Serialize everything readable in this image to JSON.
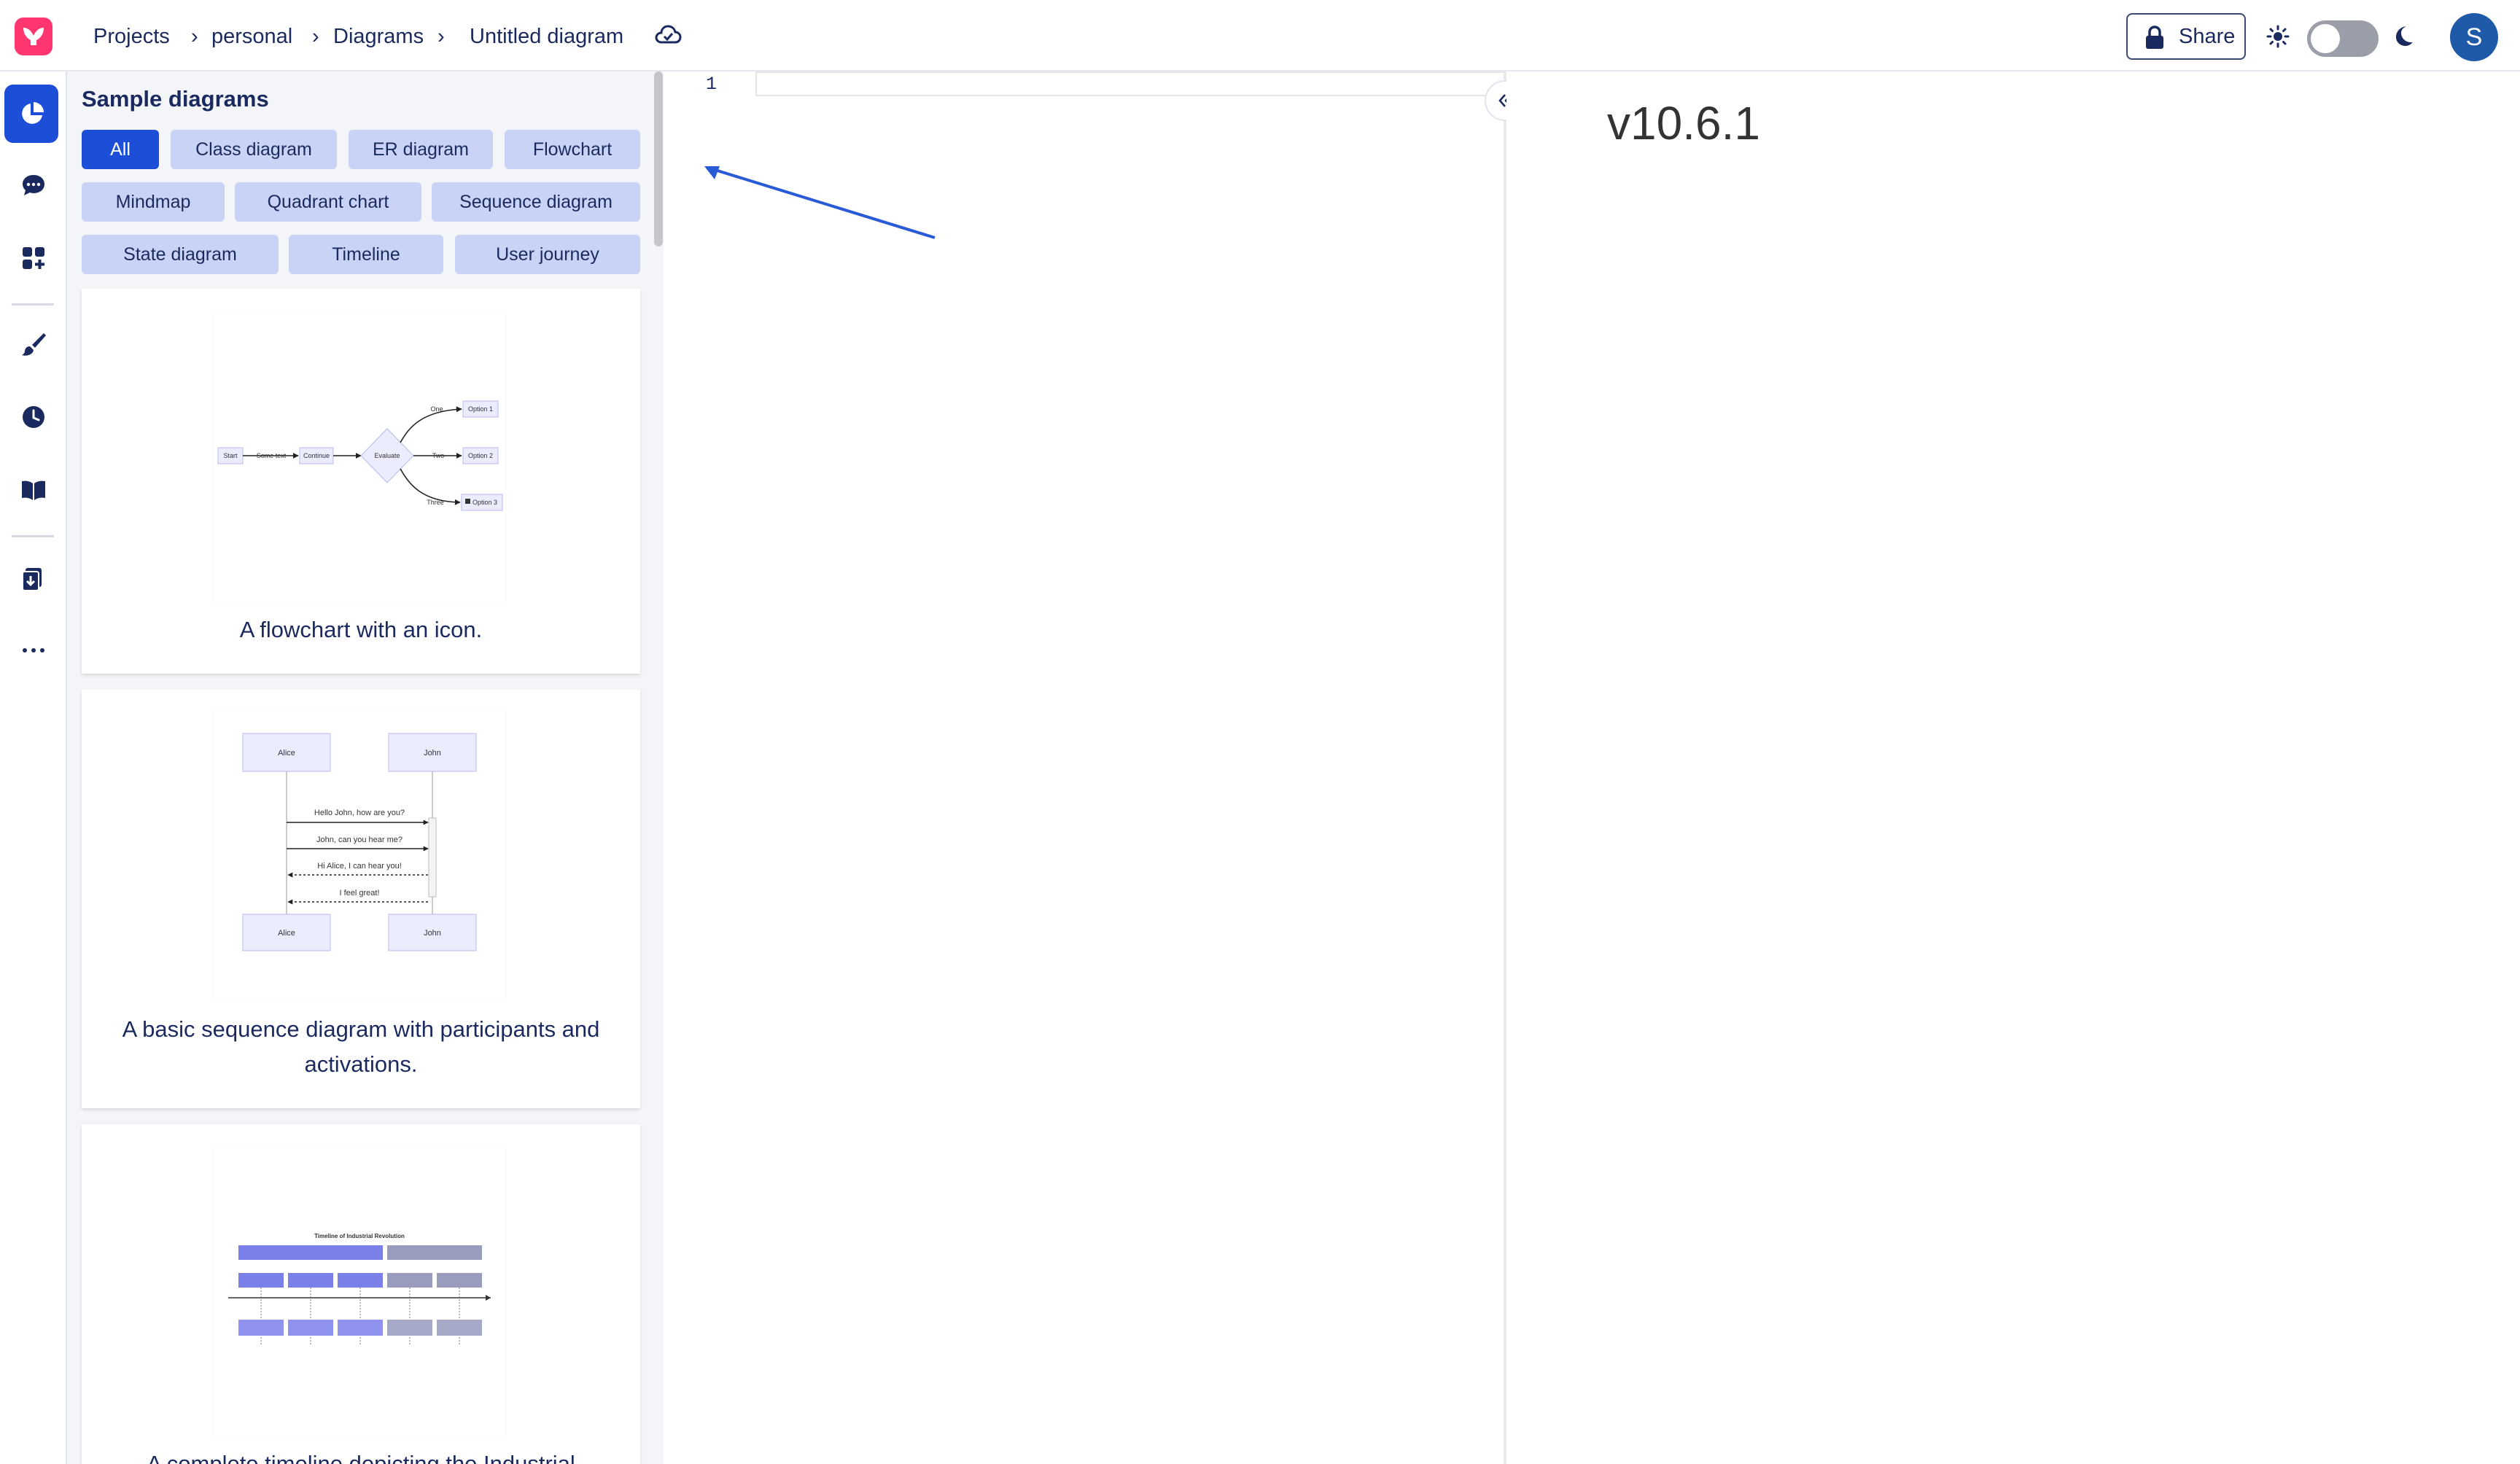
{
  "breadcrumb": {
    "projects": "Projects",
    "workspace": "personal",
    "section": "Diagrams",
    "current": "Untitled diagram"
  },
  "header": {
    "share_label": "Share",
    "avatar_initial": "S"
  },
  "samples": {
    "title": "Sample diagrams",
    "filters": [
      {
        "label": "All",
        "active": true
      },
      {
        "label": "Class diagram"
      },
      {
        "label": "ER diagram"
      },
      {
        "label": "Flowchart"
      },
      {
        "label": "Mindmap"
      },
      {
        "label": "Quadrant chart"
      },
      {
        "label": "Sequence diagram"
      },
      {
        "label": "State diagram"
      },
      {
        "label": "Timeline"
      },
      {
        "label": "User journey"
      }
    ],
    "cards": [
      {
        "caption": "A flowchart with an icon.",
        "thumb": {
          "nodes": [
            "Start",
            "Continue",
            "Evaluate",
            "Option 1",
            "Option 2",
            "Option 3"
          ],
          "edges": [
            "Some text",
            "One",
            "Two",
            "Three"
          ]
        }
      },
      {
        "caption": "A basic sequence diagram with participants and activations.",
        "thumb": {
          "participants": [
            "Alice",
            "John"
          ],
          "messages": [
            "Hello John, how are you?",
            "John, can you hear me?",
            "Hi Alice, I can hear you!",
            "I feel great!"
          ]
        }
      },
      {
        "caption": "A complete timeline depicting the Industrial Revolution.",
        "thumb": {
          "title": "Timeline of Industrial Revolution"
        }
      }
    ]
  },
  "editor": {
    "line_number": "1"
  },
  "preview": {
    "version": "v10.6.1"
  },
  "colors": {
    "accent": "#1d4ed8",
    "chip": "#c9d3f5",
    "text": "#1b2a5e",
    "logo": "#ff3670"
  }
}
